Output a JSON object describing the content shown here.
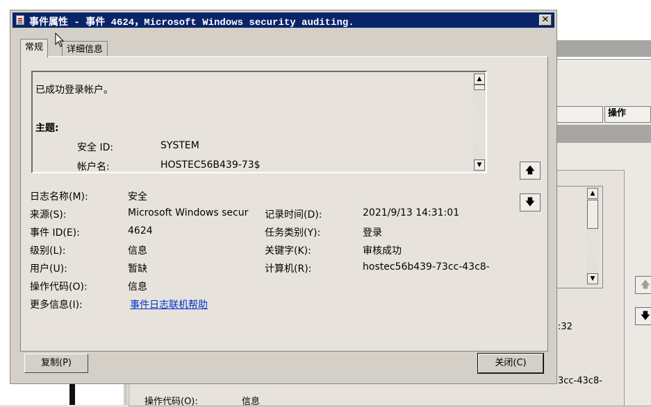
{
  "dialog": {
    "title": "事件属性 - 事件 4624，Microsoft Windows security auditing.",
    "close_glyph": "✕",
    "tabs": [
      {
        "label": "常规",
        "active": true
      },
      {
        "label": "详细信息",
        "active": false
      }
    ],
    "description_lines": [
      "已成功登录帐户。",
      "主题:",
      "安全 ID:",
      "SYSTEM",
      "帐户名:",
      "HOSTEC56B439-73$"
    ],
    "fields": {
      "log_name_label": "日志名称(M):",
      "log_name_value": "安全",
      "source_label": "来源(S):",
      "source_value": "Microsoft Windows secur",
      "logged_label": "记录时间(D):",
      "logged_value": "2021/9/13 14:31:01",
      "event_id_label": "事件 ID(E):",
      "event_id_value": "4624",
      "task_label": "任务类别(Y):",
      "task_value": "登录",
      "level_label": "级别(L):",
      "level_value": "信息",
      "keywords_label": "关键字(K):",
      "keywords_value": "审核成功",
      "user_label": "用户(U):",
      "user_value": "暂缺",
      "computer_label": "计算机(R):",
      "computer_value": "hostec56b439-73cc-43c8-",
      "opcode_label": "操作代码(O):",
      "opcode_value": "信息",
      "more_info_label": "更多信息(I):",
      "more_info_link": "事件日志联机帮助"
    },
    "copy_button": "复制(P)",
    "close_button": "关闭(C)"
  },
  "background": {
    "actions_header": "操作",
    "time_fragment": ":32",
    "computer_fragment": "3cc-43c8-",
    "opcode_label": "操作代码(O):",
    "opcode_value": "信息"
  },
  "icons": {
    "arrow_up": "▲",
    "arrow_down": "▼",
    "nav_up": "🡅",
    "nav_down": "🡇"
  }
}
